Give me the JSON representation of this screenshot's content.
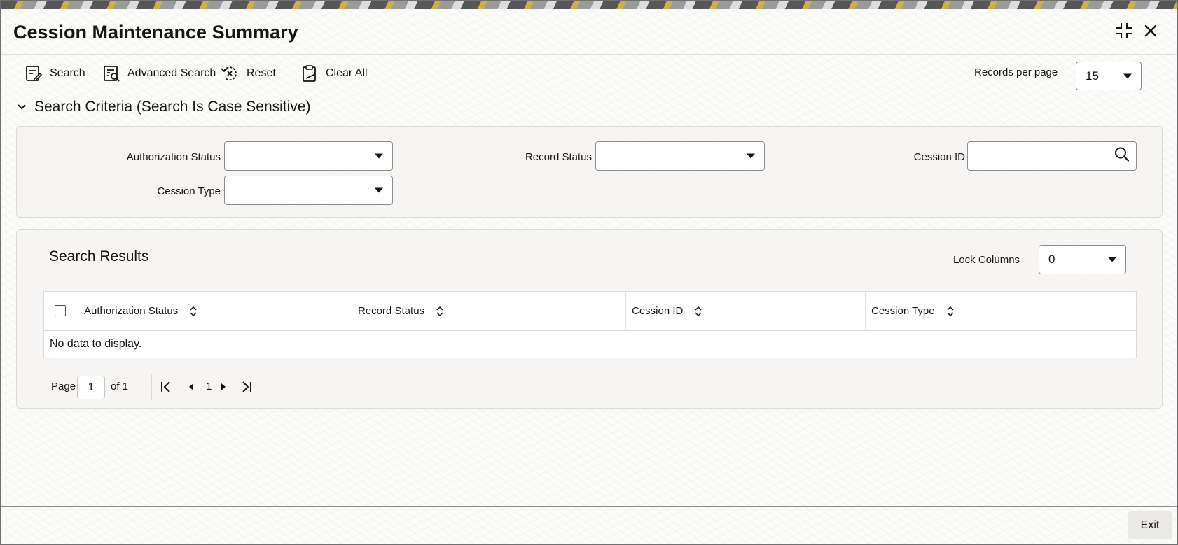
{
  "window": {
    "title": "Cession Maintenance Summary"
  },
  "toolbar": {
    "search_label": "Search",
    "advanced_search_label": "Advanced Search",
    "reset_label": "Reset",
    "clear_all_label": "Clear All",
    "records_per_page_label": "Records per page",
    "records_per_page_value": "15"
  },
  "criteria": {
    "header": "Search Criteria (Search Is Case Sensitive)",
    "authorization_status_label": "Authorization Status",
    "authorization_status_value": "",
    "record_status_label": "Record Status",
    "record_status_value": "",
    "cession_id_label": "Cession ID",
    "cession_id_value": "",
    "cession_type_label": "Cession Type",
    "cession_type_value": ""
  },
  "results": {
    "title": "Search Results",
    "lock_columns_label": "Lock Columns",
    "lock_columns_value": "0",
    "columns": [
      "Authorization Status",
      "Record Status",
      "Cession ID",
      "Cession Type"
    ],
    "empty_message": "No data to display."
  },
  "pager": {
    "page_label": "Page",
    "page_value": "1",
    "of_label": "of 1",
    "current_page": "1"
  },
  "footer": {
    "exit_label": "Exit"
  },
  "icons": {
    "maximize": "maximize-icon",
    "close": "close-icon",
    "search": "search-icon",
    "advanced_search": "advanced-search-icon",
    "reset": "reset-icon",
    "clear_all": "clear-all-icon",
    "chevron": "chevron-down-icon",
    "lookup": "magnifier-icon",
    "sort": "sort-icon",
    "first_page": "first-page-icon",
    "prev_page": "prev-page-icon",
    "next_page": "next-page-icon",
    "last_page": "last-page-icon"
  }
}
